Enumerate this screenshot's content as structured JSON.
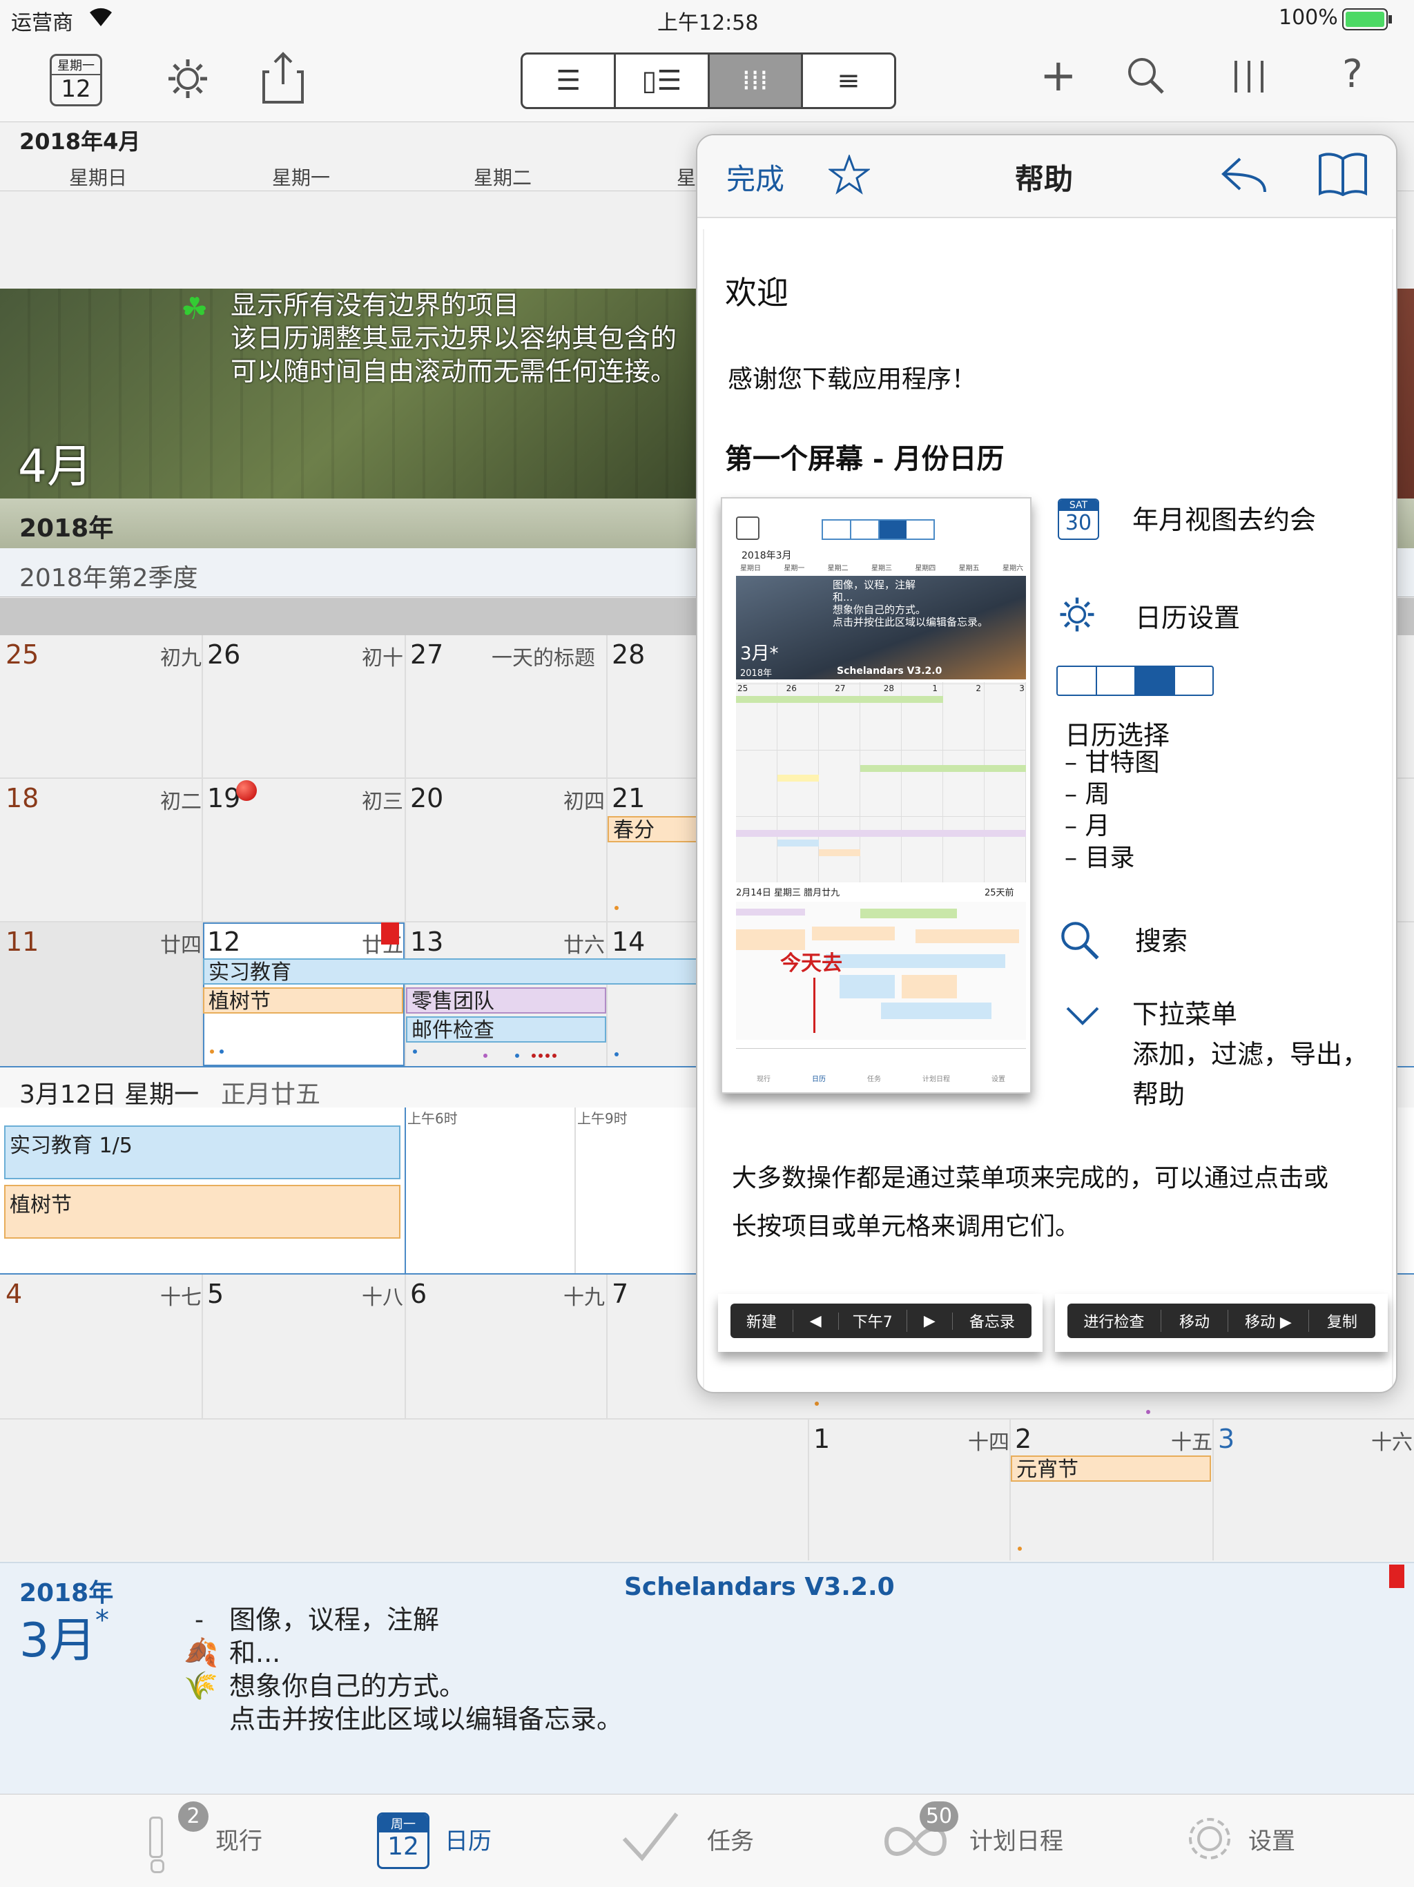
{
  "status": {
    "carrier": "运营商",
    "time": "上午12:58",
    "battery": "100%"
  },
  "toolbar": {
    "date_icon_week": "星期一",
    "date_icon_day": "12",
    "help_char": "?"
  },
  "month": {
    "title": "2018年4月",
    "weekdays": [
      "星期日",
      "星期一",
      "星期二",
      "星"
    ]
  },
  "banner": {
    "lines": [
      "显示所有没有边界的项目",
      "该日历调整其显示边界以容纳其包含的",
      "可以随时间自由滚动而无需任何连接。"
    ],
    "month": "4月",
    "year": "2018年"
  },
  "quarter": "2018年第2季度",
  "grid": {
    "row1": [
      {
        "day": "25",
        "lunar": "初九"
      },
      {
        "day": "26",
        "lunar": "初十"
      },
      {
        "day": "27",
        "lunar": "一天的标题"
      },
      {
        "day": "28",
        "lunar": ""
      }
    ],
    "row2": [
      {
        "day": "18",
        "lunar": "初二"
      },
      {
        "day": "19",
        "lunar": "初三"
      },
      {
        "day": "20",
        "lunar": "初四"
      },
      {
        "day": "21",
        "lunar": ""
      }
    ],
    "row3": [
      {
        "day": "11",
        "lunar": "廿四"
      },
      {
        "day": "12",
        "lunar": "廿五"
      },
      {
        "day": "13",
        "lunar": "廿六"
      },
      {
        "day": "14",
        "lunar": ""
      }
    ],
    "row4": [
      {
        "day": "4",
        "lunar": "十七"
      },
      {
        "day": "5",
        "lunar": "十八"
      },
      {
        "day": "6",
        "lunar": "十九"
      },
      {
        "day": "7",
        "lunar": ""
      }
    ],
    "row5": [
      {
        "day": "1",
        "lunar": "十四"
      },
      {
        "day": "2",
        "lunar": "十五"
      },
      {
        "day": "3",
        "lunar": "十六"
      }
    ],
    "events": {
      "chunfen": "春分",
      "shixi": "实习教育",
      "zhishu": "植树节",
      "lingshou": "零售团队",
      "youjian": "邮件检查",
      "yuanxiao": "元宵节"
    }
  },
  "agenda": {
    "title": "3月12日 星期一",
    "lunar": "正月廿五",
    "event1": "实习教育  1/5",
    "event2": "植树节",
    "time1": "上午6时",
    "time2": "上午9时"
  },
  "help": {
    "done": "完成",
    "title": "帮助",
    "welcome": "欢迎",
    "thanks": "感谢您下载应用程序！",
    "section1": "第一个屏幕 - 月份日历",
    "f1": "年月视图去约会",
    "sat": "SAT",
    "sat_day": "30",
    "f2": "日历设置",
    "f3": "日历选择",
    "f3_items": [
      "甘特图",
      "周",
      "月",
      "目录"
    ],
    "f4": "搜索",
    "f5": "下拉菜单",
    "f5_sub": [
      "添加，过滤，导出，",
      "帮助"
    ],
    "para": [
      "大多数操作都是通过菜单项来完成的，可以通过点击或",
      "长按项目或单元格来调用它们。"
    ],
    "menu1": [
      "新建",
      "◀",
      "下午7",
      "▶",
      "备忘录"
    ],
    "menu2": [
      "进行检查",
      "移动",
      "移动 ▶",
      "复制"
    ],
    "thumb": {
      "date": "2018年3月",
      "month": "3月*",
      "year": "2018年",
      "version": "Schelandars V3.2.0",
      "today": "今天去",
      "week": [
        "星期日",
        "星期一",
        "星期二",
        "星期三",
        "星期四",
        "星期五",
        "星期六"
      ],
      "banner_lines": [
        "图像，议程，注解",
        "和...",
        "想象你自己的方式。",
        "点击并按住此区域以编辑备忘录。"
      ],
      "agenda_line": "2月14日 星期三   腊月廿九",
      "days_ago": "25天前",
      "row_nums": [
        "25",
        "26",
        "27",
        "28",
        "1",
        "2",
        "3"
      ],
      "tab_labels": [
        "现行",
        "日历",
        "任务",
        "计划日程",
        "设置"
      ]
    }
  },
  "memo": {
    "year": "2018年",
    "month": "3月",
    "star": "*",
    "version": "Schelandars V3.2.0",
    "lines": [
      "图像，议程，注解",
      "和...",
      "想象你自己的方式。",
      "点击并按住此区域以编辑备忘录。"
    ]
  },
  "tabs": [
    {
      "label": "现行",
      "badge": "2"
    },
    {
      "label": "日历",
      "icon_week": "周一",
      "icon_day": "12"
    },
    {
      "label": "任务"
    },
    {
      "label": "计划日程",
      "badge": "50"
    },
    {
      "label": "设置"
    }
  ]
}
